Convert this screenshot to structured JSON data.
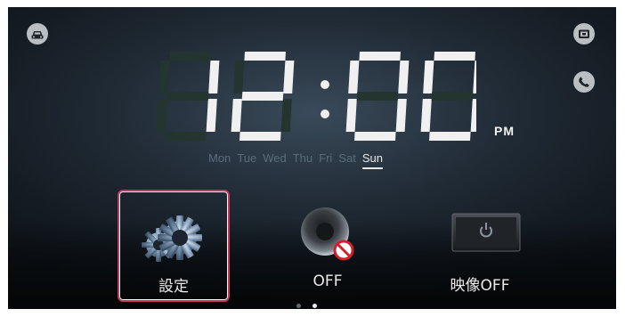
{
  "clock": {
    "time": "12:00",
    "ampm": "PM"
  },
  "days": [
    {
      "label": "Mon"
    },
    {
      "label": "Tue"
    },
    {
      "label": "Wed"
    },
    {
      "label": "Thu"
    },
    {
      "label": "Fri"
    },
    {
      "label": "Sat"
    },
    {
      "label": "Sun",
      "active": true
    }
  ],
  "menu": {
    "items": [
      {
        "label": "設定",
        "icon": "gears-icon",
        "selected": true
      },
      {
        "label": "OFF",
        "icon": "speaker-off-icon"
      },
      {
        "label": "映像OFF",
        "icon": "monitor-power-icon"
      }
    ]
  },
  "side_icons": [
    "car-icon",
    "camera-icon",
    "phone-icon"
  ],
  "pagination": {
    "pages": 2,
    "current": 2
  },
  "colors": {
    "selection_border": "#c4385a",
    "segment_on": "#f0f0f0",
    "segment_off": "#24342e",
    "day_inactive": "#5a6c7c"
  }
}
